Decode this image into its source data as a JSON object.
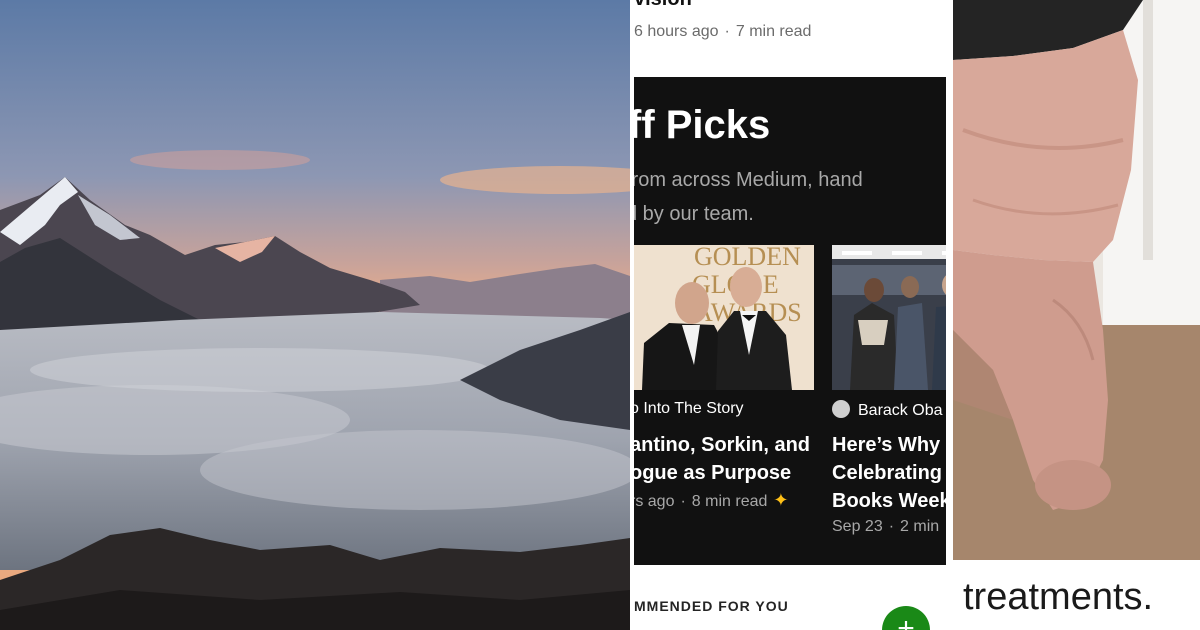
{
  "phone": {
    "article_title": "vision",
    "article_time": "6 hours ago",
    "article_read": "7 min read",
    "staff_picks": {
      "title": "ff Picks",
      "description_line1": "from across Medium, hand",
      "description_line2": "d by our team.",
      "items": [
        {
          "author": "o Into The Story",
          "headline_line1": "antino, Sorkin, and",
          "headline_line2": "ogue as Purpose",
          "time": "rs ago",
          "read": "8 min read",
          "star": "✦"
        },
        {
          "author": "Barack Oba",
          "headline_line1": "Here’s Why I",
          "headline_line2": "Celebrating",
          "headline_line3": "Books Week",
          "time": "Sep 23",
          "read": "2 min"
        }
      ]
    },
    "recommended_label": "MMENDED FOR YOU",
    "fab_label": "+"
  },
  "photo_sign": {
    "line1": "GOLDEN",
    "line2": "GLOBE",
    "line3": "AWARDS"
  },
  "caption": "treatments.",
  "colors": {
    "card_bg": "#111111",
    "fab_green": "#1a8917",
    "star_gold": "#ffc017"
  }
}
